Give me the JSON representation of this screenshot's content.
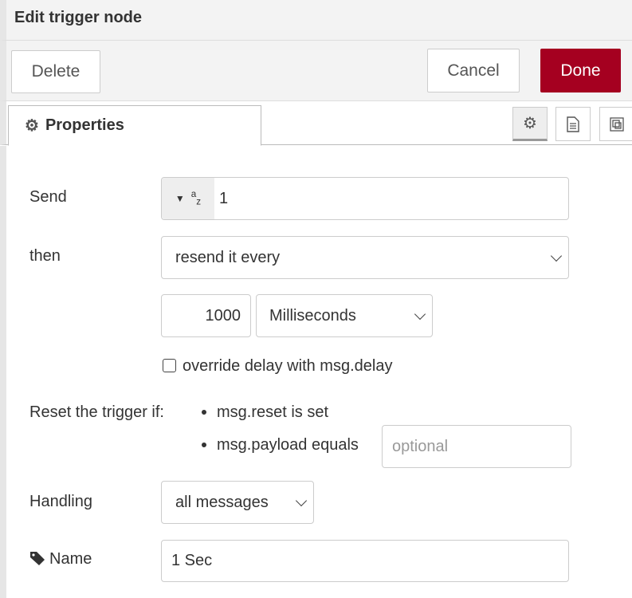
{
  "header": {
    "title": "Edit trigger node"
  },
  "toolbar": {
    "delete": "Delete",
    "cancel": "Cancel",
    "done": "Done",
    "done_color": "#a50020"
  },
  "tabs": {
    "properties": "Properties"
  },
  "form": {
    "send_label": "Send",
    "send_value": "1",
    "send_type": "az",
    "then_label": "then",
    "then_value": "resend it every",
    "delay_value": "1000",
    "delay_unit": "Milliseconds",
    "override_label": "override delay with msg.delay",
    "override_checked": false,
    "reset_label": "Reset the trigger if:",
    "reset_opt1": "msg.reset is set",
    "reset_opt2": "msg.payload equals",
    "reset_placeholder": "optional",
    "handling_label": "Handling",
    "handling_value": "all messages",
    "name_label": "Name",
    "name_value": "1 Sec"
  }
}
